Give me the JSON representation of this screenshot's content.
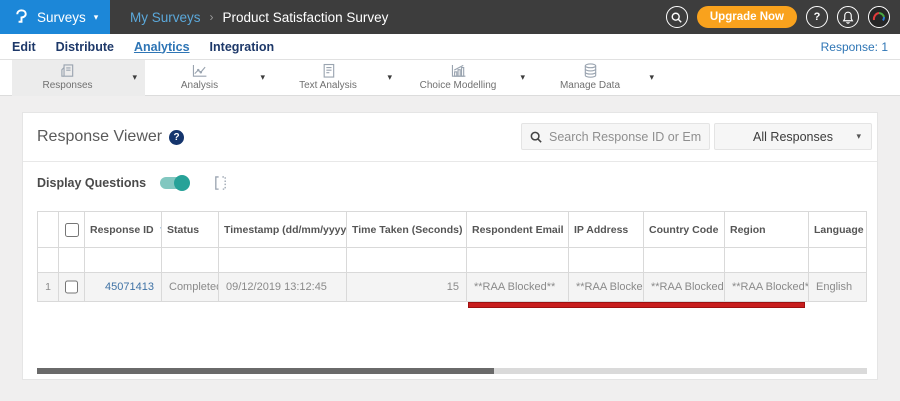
{
  "icons": {
    "caret_down": "▾",
    "breadcrumb_sep": "›",
    "help_glyph": "?",
    "sort_desc": "▼",
    "sort_both": "⇅"
  },
  "colors": {
    "brand_blue": "#1c87d8",
    "topbar_dark": "#3d3d3d",
    "upgrade_orange": "#f9a21d",
    "link_blue": "#2e75b5",
    "toggle_teal": "#27a298",
    "annotation_red": "#c81d1d"
  },
  "topbar": {
    "product": "Surveys",
    "breadcrumb_parent": "My Surveys",
    "breadcrumb_current": "Product Satisfaction Survey",
    "upgrade_label": "Upgrade Now"
  },
  "nav": {
    "items": [
      "Edit",
      "Distribute",
      "Analytics",
      "Integration"
    ],
    "active": "Analytics",
    "response_count": "Response: 1"
  },
  "toolbar": {
    "items": [
      {
        "label": "Responses",
        "active": true
      },
      {
        "label": "Analysis",
        "active": false
      },
      {
        "label": "Text Analysis",
        "active": false
      },
      {
        "label": "Choice Modelling",
        "active": false
      },
      {
        "label": "Manage Data",
        "active": false
      }
    ]
  },
  "viewer": {
    "title": "Response Viewer",
    "search_placeholder": "Search Response ID or Email",
    "filter_selected": "All Responses",
    "display_questions_label": "Display Questions",
    "toggle_state": "on"
  },
  "table": {
    "columns": [
      "Response ID",
      "Status",
      "Timestamp (dd/mm/yyyy)",
      "Time Taken (Seconds)",
      "Respondent Email",
      "IP Address",
      "Country Code",
      "Region",
      "Language"
    ],
    "rows": [
      {
        "index": "1",
        "response_id": "45071413",
        "status": "Completed",
        "timestamp": "09/12/2019 13:12:45",
        "time_taken": "15",
        "respondent_email": "**RAA Blocked**",
        "ip_address": "**RAA Blocked**",
        "country_code": "**RAA Blocked**",
        "region": "**RAA Blocked**",
        "language": "English"
      }
    ]
  }
}
